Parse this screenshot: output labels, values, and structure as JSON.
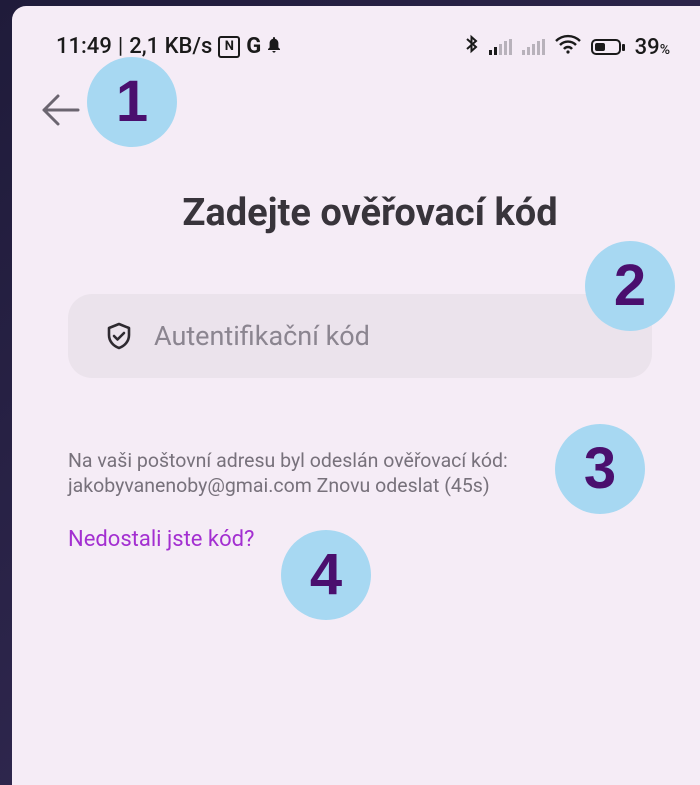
{
  "status_bar": {
    "time": "11:49",
    "separator": "|",
    "speed": "2,1 KB/s",
    "nfc": "N",
    "google": "G",
    "battery_pct": "39",
    "battery_unit": "%"
  },
  "screen": {
    "title": "Zadejte ověřovací kód",
    "code_placeholder": "Autentifikační kód",
    "info_line1": "Na vaši poštovní adresu byl odeslán ověřovací kód:",
    "email": "jakobyvanenoby@gmai.com",
    "resend_label": "Znovu odeslat (45s)",
    "help_link": "Nedostali jste kód?"
  },
  "annotations": [
    "1",
    "2",
    "3",
    "4"
  ],
  "colors": {
    "background": "#f5ecf6",
    "input_bg": "#ebe3ec",
    "link": "#a32fd1",
    "badge_bg": "#a7d8f2",
    "badge_text": "#4a0f6e"
  },
  "icons": {
    "back": "arrow-left-icon",
    "shield": "shield-check-icon",
    "notification": "bell-icon",
    "bluetooth": "bluetooth-icon",
    "wifi": "wifi-icon",
    "battery": "battery-icon"
  }
}
